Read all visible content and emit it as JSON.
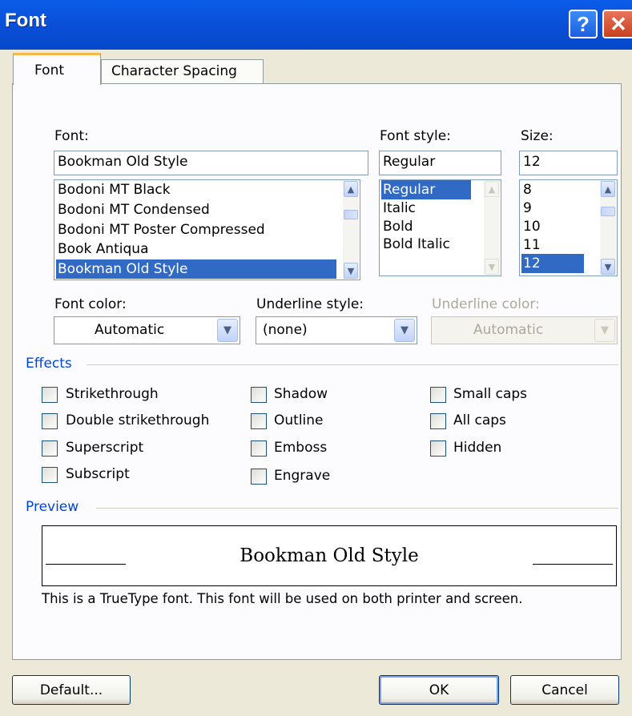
{
  "window": {
    "title": "Font",
    "help_glyph": "?",
    "close_glyph": "✕"
  },
  "tabs": [
    {
      "label": "Font",
      "active": true
    },
    {
      "label": "Character Spacing",
      "active": false
    }
  ],
  "font": {
    "label": "Font:",
    "value": "Bookman Old Style",
    "items": [
      "Bodoni MT Black",
      "Bodoni MT Condensed",
      "Bodoni MT Poster Compressed",
      "Book Antiqua",
      "Bookman Old Style"
    ],
    "selected": "Bookman Old Style"
  },
  "font_style": {
    "label": "Font style:",
    "value": "Regular",
    "items": [
      "Regular",
      "Italic",
      "Bold",
      "Bold Italic"
    ],
    "selected": "Regular"
  },
  "size": {
    "label": "Size:",
    "value": "12",
    "items": [
      "8",
      "9",
      "10",
      "11",
      "12"
    ],
    "selected": "12"
  },
  "font_color": {
    "label": "Font color:",
    "value": "Automatic"
  },
  "underline_style": {
    "label": "Underline style:",
    "value": "(none)"
  },
  "underline_color": {
    "label": "Underline color:",
    "value": "Automatic",
    "disabled": true
  },
  "effects": {
    "header": "Effects",
    "options": [
      {
        "label": "Strikethrough",
        "checked": false
      },
      {
        "label": "Double strikethrough",
        "checked": false
      },
      {
        "label": "Superscript",
        "checked": false
      },
      {
        "label": "Subscript",
        "checked": false
      },
      {
        "label": "Shadow",
        "checked": false
      },
      {
        "label": "Outline",
        "checked": false
      },
      {
        "label": "Emboss",
        "checked": false
      },
      {
        "label": "Engrave",
        "checked": false
      },
      {
        "label": "Small caps",
        "checked": false
      },
      {
        "label": "All caps",
        "checked": false
      },
      {
        "label": "Hidden",
        "checked": false
      }
    ]
  },
  "preview": {
    "header": "Preview",
    "sample": "Bookman Old Style",
    "note": "This is a TrueType font. This font will be used on both printer and screen."
  },
  "buttons": {
    "default": "Default...",
    "ok": "OK",
    "cancel": "Cancel"
  },
  "colors": {
    "titlebar": "#0a54e0",
    "selection": "#316ac5",
    "group_header": "#0046d5",
    "dialog_bg": "#ece9d8",
    "tab_accent": "#f6b847"
  }
}
